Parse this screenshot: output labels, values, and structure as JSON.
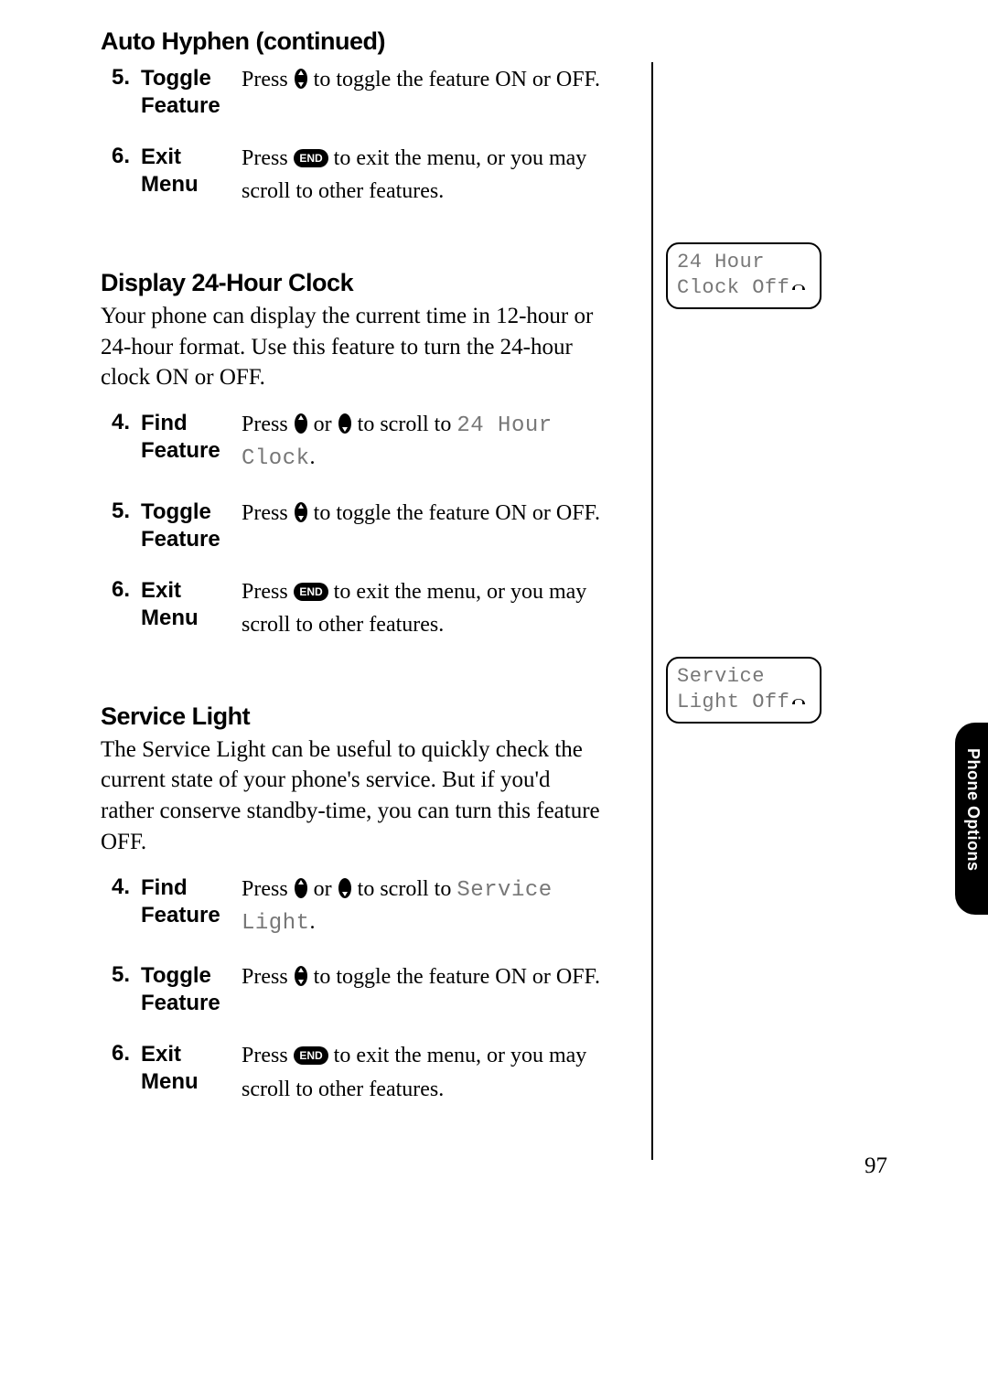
{
  "sections": {
    "auto_hyphen": {
      "heading": "Auto Hyphen (continued)",
      "steps": [
        {
          "num": "5.",
          "label_l1": "Toggle",
          "label_l2": "Feature",
          "d_pre": "Press ",
          "icon": "scroll",
          "d_post": " to toggle the feature ON or OFF."
        },
        {
          "num": "6.",
          "label_l1": "Exit",
          "label_l2": "Menu",
          "d_pre": "Press ",
          "icon": "end",
          "d_post_l1": " to exit the menu, or you may",
          "d_post_l2": "scroll to other features."
        }
      ]
    },
    "clock": {
      "heading": "Display 24-Hour Clock",
      "intro": "Your phone can display the current time in 12-hour or 24-hour format. Use this feature to turn the 24-hour clock ON or OFF.",
      "steps": [
        {
          "num": "4.",
          "label_l1": "Find",
          "label_l2": "Feature",
          "d_pre": "Press ",
          "icon": "up",
          "d_mid": " or ",
          "icon2": "down",
          "d_post_a": " to scroll to ",
          "lcd": "24 Hour Clock",
          "d_post_b": "."
        },
        {
          "num": "5.",
          "label_l1": "Toggle",
          "label_l2": "Feature",
          "d_pre": "Press ",
          "icon": "scroll",
          "d_post": " to toggle the feature ON or OFF."
        },
        {
          "num": "6.",
          "label_l1": "Exit",
          "label_l2": "Menu",
          "d_pre": "Press ",
          "icon": "end",
          "d_post_l1": " to exit the menu, or you may",
          "d_post_l2": "scroll to other features."
        }
      ]
    },
    "service_light": {
      "heading": "Service Light",
      "intro": "The Service Light can be useful to quickly check the current state of your phone's service. But if you'd rather conserve standby-time, you can turn this feature OFF.",
      "steps": [
        {
          "num": "4.",
          "label_l1": "Find",
          "label_l2": "Feature",
          "d_pre": "Press ",
          "icon": "up",
          "d_mid": " or ",
          "icon2": "down",
          "d_post_a": " to scroll to ",
          "lcd": "Service Light",
          "d_post_b": "."
        },
        {
          "num": "5.",
          "label_l1": "Toggle",
          "label_l2": "Feature",
          "d_pre": "Press ",
          "icon": "scroll",
          "d_post": " to toggle the feature ON or OFF."
        },
        {
          "num": "6.",
          "label_l1": "Exit",
          "label_l2": "Menu",
          "d_pre": "Press ",
          "icon": "end",
          "d_post_l1": " to exit the menu, or you may",
          "d_post_l2": "scroll to other features."
        }
      ]
    }
  },
  "sideboxes": {
    "clock": {
      "l1": "24 Hour",
      "l2": "Clock Off"
    },
    "service": {
      "l1": "Service",
      "l2": "Light Off"
    }
  },
  "thumb_tab": "Phone Options",
  "page_number": "97"
}
